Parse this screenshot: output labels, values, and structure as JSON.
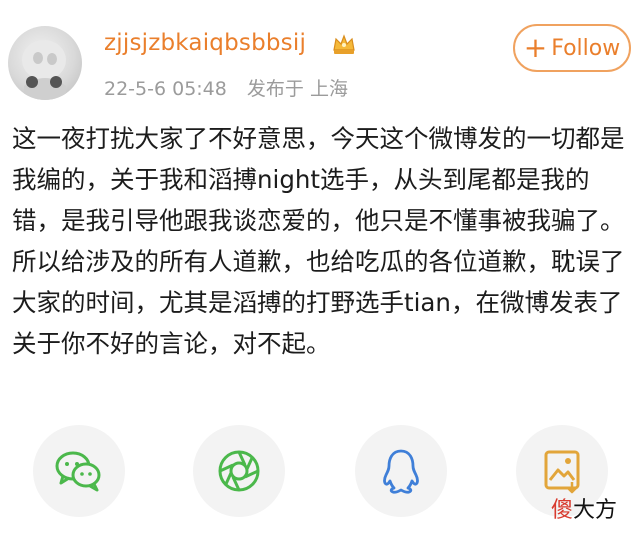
{
  "user": {
    "name": "zjjsjzbkaiqbsbbsij",
    "date": "22-5-6 05:48",
    "location": "发布于 上海",
    "avatar_icon": "user-avatar",
    "badge_icon": "crown-badge-icon"
  },
  "follow_label": "Follow",
  "post_text": "这一夜打扰大家了不好意思，今天这个微博发的一切都是我编的，关于我和滔搏night选手，从头到尾都是我的错，是我引导他跟我谈恋爱的，他只是不懂事被我骗了。所以给涉及的所有人道歉，也给吃瓜的各位道歉，耽误了大家的时间，尤其是滔搏的打野选手tian，在微博发表了关于你不好的言论，对不起。",
  "share": [
    {
      "icon": "wechat-icon"
    },
    {
      "icon": "moments-icon"
    },
    {
      "icon": "qq-icon"
    },
    {
      "icon": "save-image-icon"
    }
  ],
  "watermark": {
    "accent": "傻",
    "rest": "大方"
  },
  "colors": {
    "accent": "#ea7f2c",
    "wechat": "#4bb84b",
    "moments": "#4bb84b",
    "qq": "#3f7fd8",
    "save": "#e2a53a"
  }
}
